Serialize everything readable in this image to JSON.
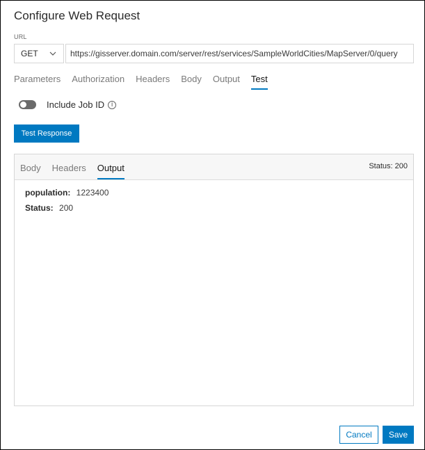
{
  "dialog": {
    "title": "Configure Web Request"
  },
  "request": {
    "url_label": "URL",
    "method": "GET",
    "url": "https://gisserver.domain.com/server/rest/services/SampleWorldCities/MapServer/0/query"
  },
  "tabs": [
    {
      "label": "Parameters",
      "active": false
    },
    {
      "label": "Authorization",
      "active": false
    },
    {
      "label": "Headers",
      "active": false
    },
    {
      "label": "Body",
      "active": false
    },
    {
      "label": "Output",
      "active": false
    },
    {
      "label": "Test",
      "active": true
    }
  ],
  "include_job_id": {
    "label": "Include Job ID",
    "enabled": false,
    "info_icon": "info-icon"
  },
  "test_button": {
    "label": "Test Response"
  },
  "response_panel": {
    "tabs": [
      {
        "label": "Body",
        "active": false
      },
      {
        "label": "Headers",
        "active": false
      },
      {
        "label": "Output",
        "active": true
      }
    ],
    "status_label": "Status:",
    "status_value": "200",
    "output": [
      {
        "key": "population:",
        "value": "1223400"
      },
      {
        "key": "Status:",
        "value": "200"
      }
    ]
  },
  "footer": {
    "cancel_label": "Cancel",
    "save_label": "Save"
  },
  "colors": {
    "accent": "#0079c1"
  }
}
